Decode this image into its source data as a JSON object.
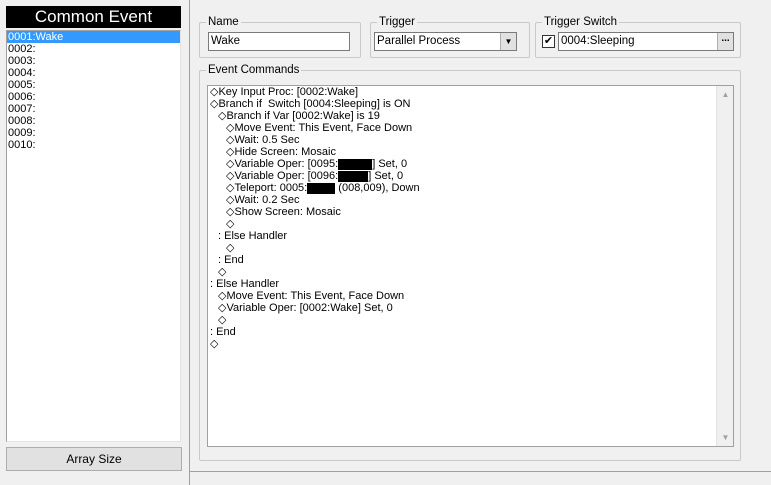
{
  "left": {
    "title": "Common Event",
    "events": [
      "0001:Wake",
      "0002:",
      "0003:",
      "0004:",
      "0005:",
      "0006:",
      "0007:",
      "0008:",
      "0009:",
      "0010:"
    ],
    "selected_index": 0,
    "array_size_label": "Array Size"
  },
  "name_group": {
    "legend": "Name",
    "value": "Wake"
  },
  "trigger_group": {
    "legend": "Trigger",
    "value": "Parallel Process"
  },
  "switch_group": {
    "legend": "Trigger Switch",
    "checked": true,
    "value": "0004:Sleeping",
    "button_label": "..."
  },
  "commands_group": {
    "legend": "Event Commands",
    "lines": [
      {
        "indent": 0,
        "parts": [
          "◇Key Input Proc: [0002:Wake]"
        ]
      },
      {
        "indent": 0,
        "parts": [
          "◇Branch if  Switch [0004:Sleeping] is ON"
        ]
      },
      {
        "indent": 1,
        "parts": [
          "◇Branch if Var [0002:Wake] is 19"
        ]
      },
      {
        "indent": 2,
        "parts": [
          "◇Move Event: This Event, Face Down"
        ]
      },
      {
        "indent": 2,
        "parts": [
          "◇Wait: 0.5 Sec"
        ]
      },
      {
        "indent": 2,
        "parts": [
          "◇Hide Screen: Mosaic"
        ]
      },
      {
        "indent": 2,
        "parts": [
          "◇Variable Oper: [0095:",
          {
            "redact": 34
          },
          "] Set, 0"
        ]
      },
      {
        "indent": 2,
        "parts": [
          "◇Variable Oper: [0096:",
          {
            "redact": 30
          },
          "] Set, 0"
        ]
      },
      {
        "indent": 2,
        "parts": [
          "◇Teleport: 0005:",
          {
            "redact": 28
          },
          " (008,009), Down"
        ]
      },
      {
        "indent": 2,
        "parts": [
          "◇Wait: 0.2 Sec"
        ]
      },
      {
        "indent": 2,
        "parts": [
          "◇Show Screen: Mosaic"
        ]
      },
      {
        "indent": 2,
        "parts": [
          "◇"
        ]
      },
      {
        "indent": 1,
        "parts": [
          ": Else Handler"
        ]
      },
      {
        "indent": 2,
        "parts": [
          "◇"
        ]
      },
      {
        "indent": 1,
        "parts": [
          ": End"
        ]
      },
      {
        "indent": 1,
        "parts": [
          "◇"
        ]
      },
      {
        "indent": 0,
        "parts": [
          ": Else Handler"
        ]
      },
      {
        "indent": 1,
        "parts": [
          "◇Move Event: This Event, Face Down"
        ]
      },
      {
        "indent": 1,
        "parts": [
          "◇Variable Oper: [0002:Wake] Set, 0"
        ]
      },
      {
        "indent": 1,
        "parts": [
          "◇"
        ]
      },
      {
        "indent": 0,
        "parts": [
          ": End"
        ]
      },
      {
        "indent": 0,
        "parts": [
          "◇"
        ]
      }
    ]
  }
}
